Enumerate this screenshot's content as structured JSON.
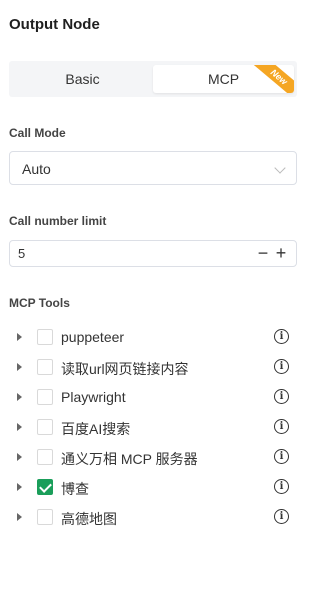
{
  "panel": {
    "title": "Output Node"
  },
  "tabs": [
    {
      "label": "Basic",
      "active": false
    },
    {
      "label": "MCP",
      "active": true,
      "badge": "New"
    }
  ],
  "call_mode": {
    "label": "Call Mode",
    "value": "Auto"
  },
  "call_limit": {
    "label": "Call number limit",
    "value": "5",
    "minus": "−",
    "plus": "+"
  },
  "mcp_tools": {
    "label": "MCP Tools",
    "info_glyph": "i",
    "items": [
      {
        "name": "puppeteer",
        "checked": false
      },
      {
        "name": "读取url网页链接内容",
        "checked": false
      },
      {
        "name": "Playwright",
        "checked": false
      },
      {
        "name": "百度AI搜索",
        "checked": false
      },
      {
        "name": "通义万相 MCP 服务器",
        "checked": false
      },
      {
        "name": "博查",
        "checked": true
      },
      {
        "name": "高德地图",
        "checked": false
      }
    ]
  },
  "colors": {
    "accent": "#1a9e5a",
    "badge": "#f5a623"
  }
}
